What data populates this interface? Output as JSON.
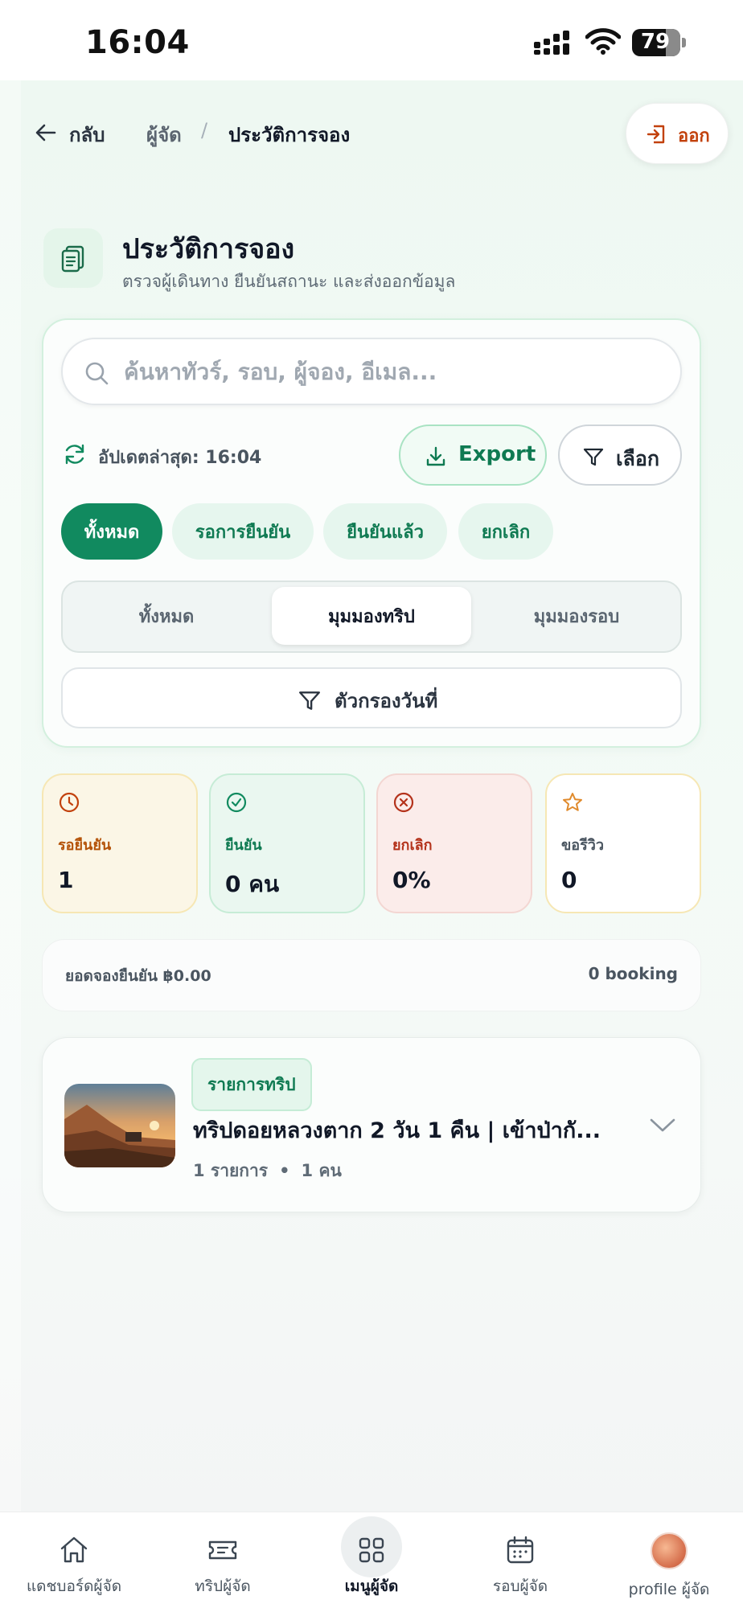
{
  "status_bar": {
    "time": "16:04",
    "battery": "79"
  },
  "breadcrumb": {
    "back": "กลับ",
    "organizer": "ผู้จัด",
    "separator": "/",
    "current": "ประวัติการจอง"
  },
  "logout": {
    "label": "ออก"
  },
  "header": {
    "title": "ประวัติการจอง",
    "subtitle": "ตรวจผู้เดินทาง ยืนยันสถานะ และส่งออกข้อมูล"
  },
  "search": {
    "placeholder": "ค้นหาทัวร์, รอบ, ผู้จอง, อีเมล...",
    "value": ""
  },
  "toolbar": {
    "updated": "อัปเดตล่าสุด: 16:04",
    "export_label": "Export",
    "select_label": "เลือก"
  },
  "status_filters": [
    {
      "label": "ทั้งหมด",
      "active": true
    },
    {
      "label": "รอการยืนยัน",
      "active": false
    },
    {
      "label": "ยืนยันแล้ว",
      "active": false
    },
    {
      "label": "ยกเลิก",
      "active": false
    }
  ],
  "view_modes": [
    {
      "label": "ทั้งหมด",
      "active": false
    },
    {
      "label": "มุมมองทริป",
      "active": true
    },
    {
      "label": "มุมมองรอบ",
      "active": false
    }
  ],
  "date_filter": {
    "label": "ตัวกรองวันที่"
  },
  "stats": {
    "pending": {
      "label": "รอยืนยัน",
      "value": "1",
      "icon": "clock-icon"
    },
    "confirmed": {
      "label": "ยืนยัน",
      "value": "0 คน",
      "icon": "check-circle-icon"
    },
    "cancelled": {
      "label": "ยกเลิก",
      "value": "0%",
      "icon": "x-circle-icon"
    },
    "review": {
      "label": "ขอรีวิว",
      "value": "0",
      "icon": "star-icon"
    }
  },
  "summary": {
    "confirmed_total": "ยอดจองยืนยัน ฿0.00",
    "booking_count": "0 booking"
  },
  "trip_card": {
    "tag": "รายการทริป",
    "title": "ทริปดอยหลวงตาก 2 วัน 1 คืน | เข้าป่ากั...",
    "items": "1 รายการ",
    "dot": "•",
    "people": "1 คน"
  },
  "nav": {
    "items": [
      {
        "label": "แดชบอร์ดผู้จัด",
        "icon": "home-icon"
      },
      {
        "label": "ทริปผู้จัด",
        "icon": "ticket-icon"
      },
      {
        "label": "เมนูผู้จัด",
        "icon": "grid-icon",
        "active": true
      },
      {
        "label": "รอบผู้จัด",
        "icon": "calendar-icon"
      },
      {
        "label": "profile ผู้จัด",
        "icon": "avatar"
      }
    ]
  },
  "colors": {
    "primary": "#118a5f",
    "primary_light": "#e6f6ee",
    "danger": "#c2410c",
    "warning": "#b45309"
  }
}
